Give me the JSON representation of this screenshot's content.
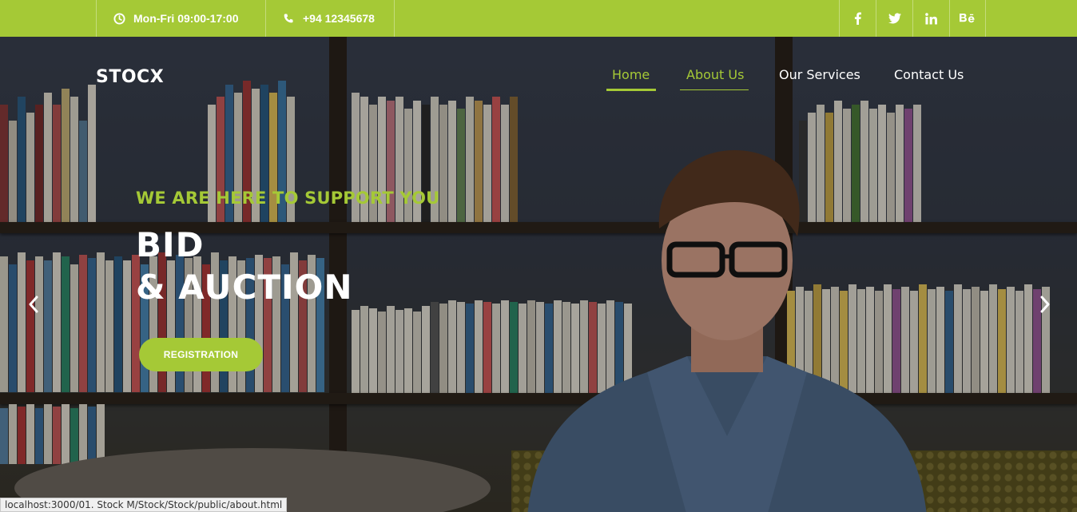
{
  "topbar": {
    "hours": "Mon-Fri 09:00-17:00",
    "phone": "+94 12345678",
    "socials": [
      {
        "name": "facebook",
        "label": "f"
      },
      {
        "name": "twitter",
        "label": "t"
      },
      {
        "name": "linkedin",
        "label": "in"
      },
      {
        "name": "behance",
        "label": "Bē"
      }
    ]
  },
  "brand": "STOCX",
  "nav": {
    "home": "Home",
    "about": "About Us",
    "services": "Our Services",
    "contact": "Contact Us"
  },
  "hero": {
    "tagline": "WE ARE HERE TO SUPPORT YOU",
    "headline_line1": "BID",
    "headline_line2": "& AUCTION",
    "button": "REGISTRATION"
  },
  "status_url": "localhost:3000/01. Stock M/Stock/Stock/public/about.html",
  "colors": {
    "accent": "#a5c936",
    "text": "#ffffff"
  },
  "icons": {
    "hours": "clock-icon",
    "phone": "phone-icon",
    "prev": "chevron-left-icon",
    "next": "chevron-right-icon"
  }
}
